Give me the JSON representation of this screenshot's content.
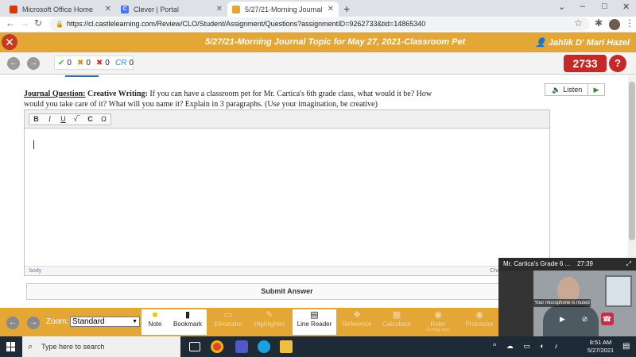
{
  "browser": {
    "tabs": [
      {
        "label": "Microsoft Office Home",
        "color": "#d83b01"
      },
      {
        "label": "Clever | Portal",
        "color": "#4274f6",
        "glyph": "C"
      },
      {
        "label": "5/27/21-Morning Journal Topic f",
        "color": "#e4a634"
      }
    ],
    "url": "https://cl.castlelearning.com/Review/CLO/Student/Assignment/Questions?assignmentID=9262733&tid=14865340"
  },
  "app": {
    "title": "5/27/21-Morning Journal Topic for May 27, 2021-Classroom Pet",
    "user": "Jahlik D' Mari Hazel",
    "score": "2733",
    "help": "?"
  },
  "counts": {
    "correct": "0",
    "partial": "0",
    "wrong": "0",
    "cr_label": "CR",
    "cr": "0"
  },
  "question": {
    "label": "Journal Question:",
    "category": "Creative Writing:",
    "text": "If you can have a classroom pet for Mr. Cartica's 6th grade class, what would it be? How would you take care of it? What will you name it? Explain in 3 paragraphs. (Use your imagination, be creative)",
    "listen": "Listen"
  },
  "editor": {
    "buttons": [
      "B",
      "I",
      "U",
      "√‾",
      "C",
      "Ω"
    ],
    "status_left": "body",
    "status_right": "Cha"
  },
  "submit": "Submit Answer",
  "tools": {
    "zoom_label": "Zoom:",
    "zoom_value": "Standard",
    "items": [
      {
        "label": "Note",
        "enabled": true
      },
      {
        "label": "Bookmark",
        "enabled": true
      },
      {
        "label": "Eliminator",
        "enabled": false
      },
      {
        "label": "Highlighter",
        "enabled": false
      },
      {
        "label": "Line Reader",
        "enabled": true
      },
      {
        "label": "Reference",
        "enabled": false
      },
      {
        "label": "Calculator",
        "enabled": false
      },
      {
        "label": "Ruler",
        "enabled": false,
        "sub": "Coming soon"
      },
      {
        "label": "Protractor",
        "enabled": false
      }
    ]
  },
  "video": {
    "title": "Mr. Cartica's Grade 6 ...",
    "time": "27:39",
    "muted": "Your microphone is muted"
  },
  "taskbar": {
    "search": "Type here to search",
    "time": "8:51 AM",
    "date": "5/27/2021"
  }
}
